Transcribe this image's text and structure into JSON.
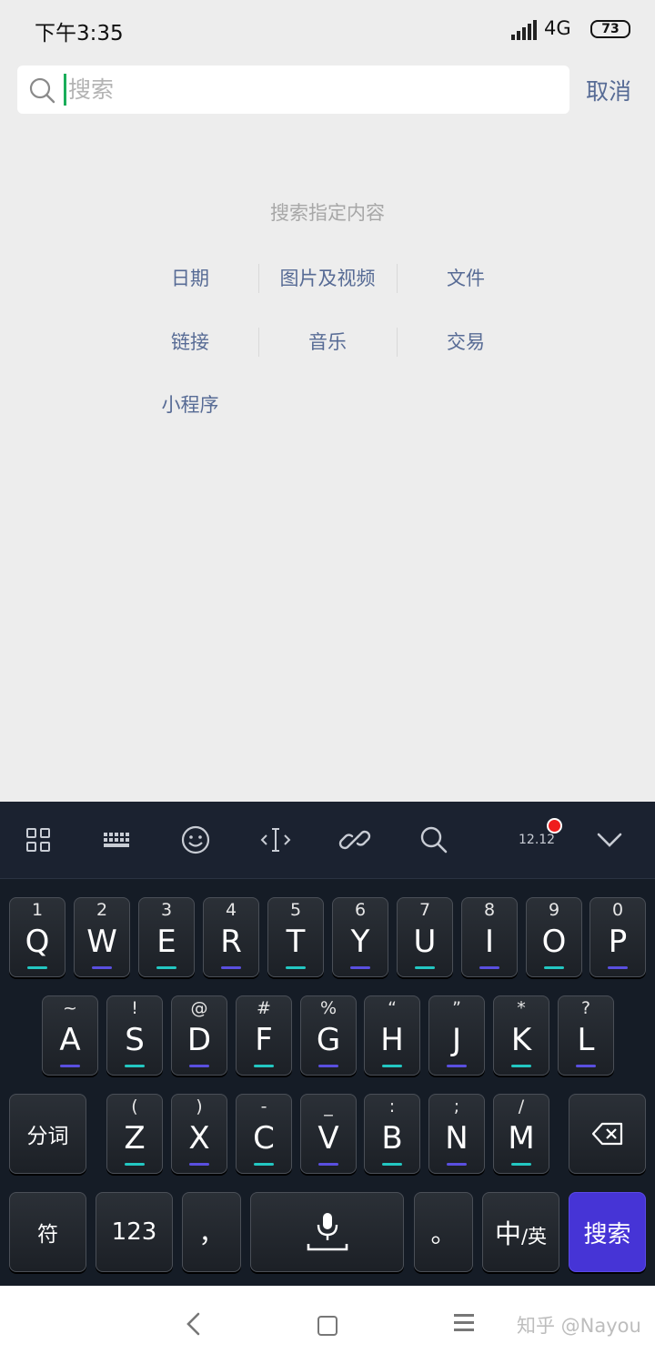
{
  "status_bar": {
    "time": "下午3:35",
    "network": "4G",
    "battery": "73"
  },
  "search": {
    "placeholder": "搜索",
    "value": "",
    "cancel_label": "取消"
  },
  "specific_search": {
    "title": "搜索指定内容",
    "items": [
      "日期",
      "图片及视频",
      "文件",
      "链接",
      "音乐",
      "交易",
      "小程序"
    ]
  },
  "keyboard": {
    "toolbar_date": "12.12",
    "row1": [
      {
        "sub": "1",
        "main": "Q"
      },
      {
        "sub": "2",
        "main": "W"
      },
      {
        "sub": "3",
        "main": "E"
      },
      {
        "sub": "4",
        "main": "R"
      },
      {
        "sub": "5",
        "main": "T"
      },
      {
        "sub": "6",
        "main": "Y"
      },
      {
        "sub": "7",
        "main": "U"
      },
      {
        "sub": "8",
        "main": "I"
      },
      {
        "sub": "9",
        "main": "O"
      },
      {
        "sub": "0",
        "main": "P"
      }
    ],
    "row2": [
      {
        "sub": "~",
        "main": "A"
      },
      {
        "sub": "!",
        "main": "S"
      },
      {
        "sub": "@",
        "main": "D"
      },
      {
        "sub": "#",
        "main": "F"
      },
      {
        "sub": "%",
        "main": "G"
      },
      {
        "sub": "“",
        "main": "H"
      },
      {
        "sub": "”",
        "main": "J"
      },
      {
        "sub": "*",
        "main": "K"
      },
      {
        "sub": "?",
        "main": "L"
      }
    ],
    "row3": [
      {
        "sub": "(",
        "main": "Z"
      },
      {
        "sub": ")",
        "main": "X"
      },
      {
        "sub": "-",
        "main": "C"
      },
      {
        "sub": "_",
        "main": "V"
      },
      {
        "sub": ":",
        "main": "B"
      },
      {
        "sub": ";",
        "main": "N"
      },
      {
        "sub": "/",
        "main": "M"
      }
    ],
    "segment_label": "分词",
    "symbols_label": "符",
    "numbers_label": "123",
    "comma_label": "，",
    "period_label": "。",
    "lang_main": "中",
    "lang_sub": "/英",
    "search_label": "搜索"
  },
  "watermark": "知乎 @Nayou"
}
